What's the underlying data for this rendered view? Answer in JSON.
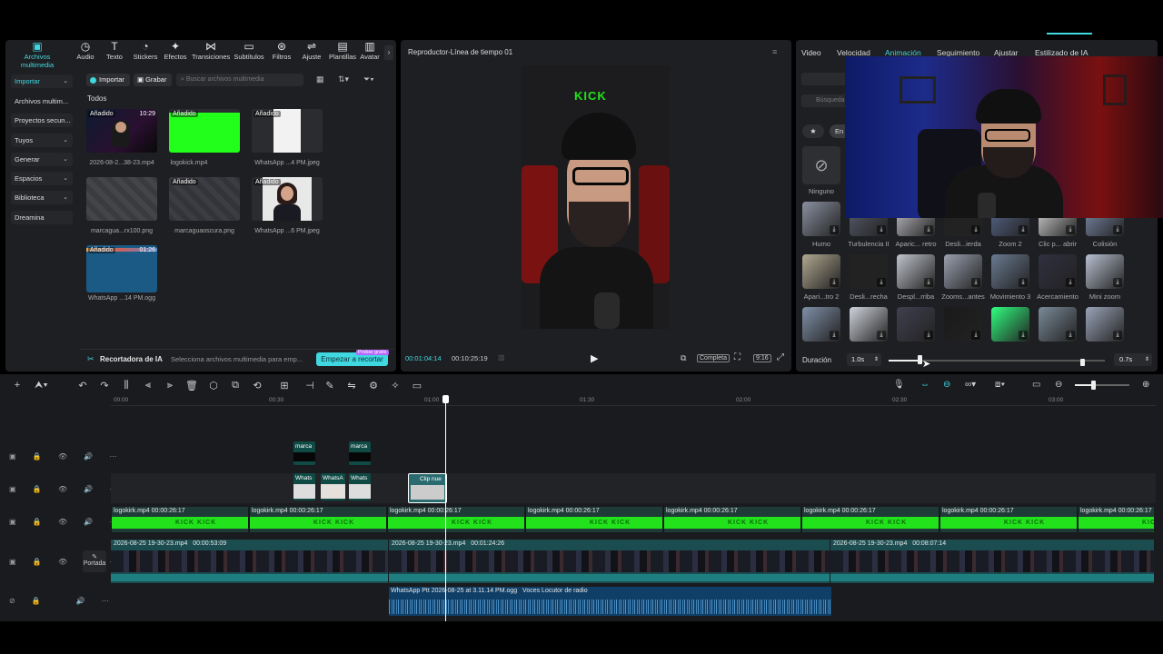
{
  "categories": [
    {
      "label": "Archivos multimedia",
      "icon": "media-icon",
      "active": true
    },
    {
      "label": "Audio",
      "icon": "audio-icon"
    },
    {
      "label": "Texto",
      "icon": "text-icon"
    },
    {
      "label": "Stickers",
      "icon": "sticker-icon"
    },
    {
      "label": "Efectos",
      "icon": "effects-icon"
    },
    {
      "label": "Transiciones",
      "icon": "transition-icon"
    },
    {
      "label": "Subtítulos",
      "icon": "subtitle-icon"
    },
    {
      "label": "Filtros",
      "icon": "filter-icon"
    },
    {
      "label": "Ajuste",
      "icon": "adjust-icon"
    },
    {
      "label": "Plantillas",
      "icon": "template-icon"
    },
    {
      "label": "Avatar",
      "icon": "avatar-icon"
    }
  ],
  "sidebar": {
    "items": [
      {
        "label": "Importar",
        "chevron": true,
        "active": true
      },
      {
        "label": "Archivos multim..."
      },
      {
        "label": "Proyectos secun..."
      },
      {
        "label": "Tuyos",
        "chevron": true
      },
      {
        "label": "Generar",
        "chevron": true
      },
      {
        "label": "Espacios",
        "chevron": true
      },
      {
        "label": "Biblioteca",
        "chevron": true
      },
      {
        "label": "Dreamina"
      }
    ]
  },
  "media_toolbar": {
    "import_label": "Importar",
    "record_label": "Grabar",
    "search_placeholder": "Buscar archivos multimedia",
    "filter_label": "Todos"
  },
  "media_items": [
    {
      "name": "2026-08-2...38-23.mp4",
      "tag": "Añadido",
      "duration": "10:29"
    },
    {
      "name": "logokick.mp4",
      "tag": "Añadido",
      "duration": ""
    },
    {
      "name": "WhatsApp ...4 PM.jpeg",
      "tag": "Añadido",
      "duration": ""
    },
    {
      "name": "marcagua...rx100.png",
      "tag": "",
      "duration": ""
    },
    {
      "name": "marcaguaoscura.png",
      "tag": "Añadido",
      "duration": ""
    },
    {
      "name": "WhatsApp ...6 PM.jpeg",
      "tag": "Añadido",
      "duration": ""
    },
    {
      "name": "WhatsApp ...14 PM.ogg",
      "tag": "Añadido",
      "duration": "01:26"
    }
  ],
  "ai_bar": {
    "title": "Recortadora de IA",
    "desc": "Selecciona archivos multimedia para emp...",
    "button": "Empezar a recortar",
    "badge": "Probar gratis"
  },
  "player": {
    "title": "Reproductor-Línea de tiempo 01",
    "current_time": "00:01:04:14",
    "total_time": "00:10:25:19",
    "full_label": "Completa",
    "ratio_label": "9:16",
    "overlay_text": "KICK"
  },
  "right_tabs": [
    {
      "label": "Video"
    },
    {
      "label": "Velocidad"
    },
    {
      "label": "Animación",
      "active": true
    },
    {
      "label": "Seguimiento"
    },
    {
      "label": "Ajustar"
    },
    {
      "label": "Estilizado de IA"
    }
  ],
  "anim_panel": {
    "search_placeholder": "Búsqueda",
    "chip": "En",
    "none_label": "Ninguno",
    "rows": [
      [
        "Humo",
        "Turbulencia II",
        "Aparic... retro",
        "Desli...ierda",
        "Zoom 2",
        "Clic p... abrir",
        "Colisión"
      ],
      [
        "Apari...tro 2",
        "Desli...recha",
        "Despl...rriba",
        "Zooms...antes",
        "Movimiento 3",
        "Acercamiento",
        "Mini zoom"
      ],
      [
        "Balan...abajo",
        "Desplazar",
        "Estira...ctado",
        "Girar",
        "Trueno sónico",
        "Desp...ento",
        "Balan...arriba"
      ]
    ],
    "duration_label": "Duración",
    "duration_in": "1.0s",
    "duration_out": "0.7s"
  },
  "ruler": [
    "00:00",
    "00:30",
    "01:00",
    "01:30",
    "02:00",
    "02:30",
    "03:00"
  ],
  "tracks": {
    "sticker_label": "marca",
    "whats_label": "Whats",
    "whats_label2": "WhatsA",
    "clip_label": "Clip nue",
    "green_clip_name": "logokirk.mp4",
    "green_clip_dur": "00:00:26:17",
    "green_clip_text": "KICK    KICK",
    "cover_label": "Portada",
    "video_clips": [
      {
        "name": "2026-08-25 19-30-23.mp4",
        "dur": "00:00:53:09"
      },
      {
        "name": "2026-08-25 19-30-23.mp4",
        "dur": "00:01:24:26"
      },
      {
        "name": "2026-08-25 19-30-23.mp4",
        "dur": "00:08:07:14"
      }
    ],
    "audio_clip": "WhatsApp Ptt 2026-08-25 at 3.11.14 PM.ogg",
    "audio_effect": "Voces Locutor de radio"
  },
  "colors": {
    "accent": "#3fd8e0",
    "green": "#22e31b",
    "panel": "#1e1f22"
  }
}
